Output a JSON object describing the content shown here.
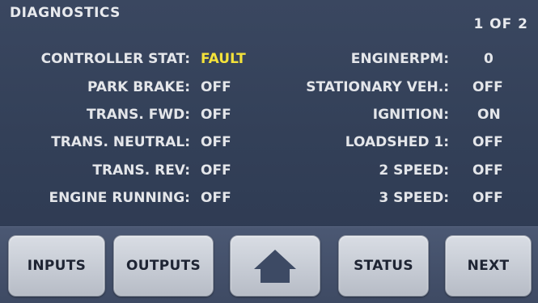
{
  "header": {
    "title": "DIAGNOSTICS",
    "page": "1 OF 2"
  },
  "left_rows": [
    {
      "label": "CONTROLLER STAT:",
      "value": "FAULT"
    },
    {
      "label": "PARK BRAKE:",
      "value": "OFF"
    },
    {
      "label": "TRANS. FWD:",
      "value": "OFF"
    },
    {
      "label": "TRANS. NEUTRAL:",
      "value": "OFF"
    },
    {
      "label": "TRANS. REV:",
      "value": "OFF"
    },
    {
      "label": "ENGINE RUNNING:",
      "value": "OFF"
    }
  ],
  "right_rows": [
    {
      "label": "ENGINERPM:",
      "value": "0"
    },
    {
      "label": "STATIONARY VEH.:",
      "value": "OFF"
    },
    {
      "label": "IGNITION:",
      "value": "ON"
    },
    {
      "label": "LOADSHED 1:",
      "value": "OFF"
    },
    {
      "label": "2 SPEED:",
      "value": "OFF"
    },
    {
      "label": "3 SPEED:",
      "value": "OFF"
    }
  ],
  "buttons": {
    "inputs": "INPUTS",
    "outputs": "OUTPUTS",
    "home_icon": "home-icon",
    "status": "STATUS",
    "next": "NEXT"
  },
  "colors": {
    "background": "#334058",
    "text": "#e4e6ea",
    "fault": "#f3e23a",
    "button": "#c6cbd4",
    "button_text": "#1e2433"
  }
}
